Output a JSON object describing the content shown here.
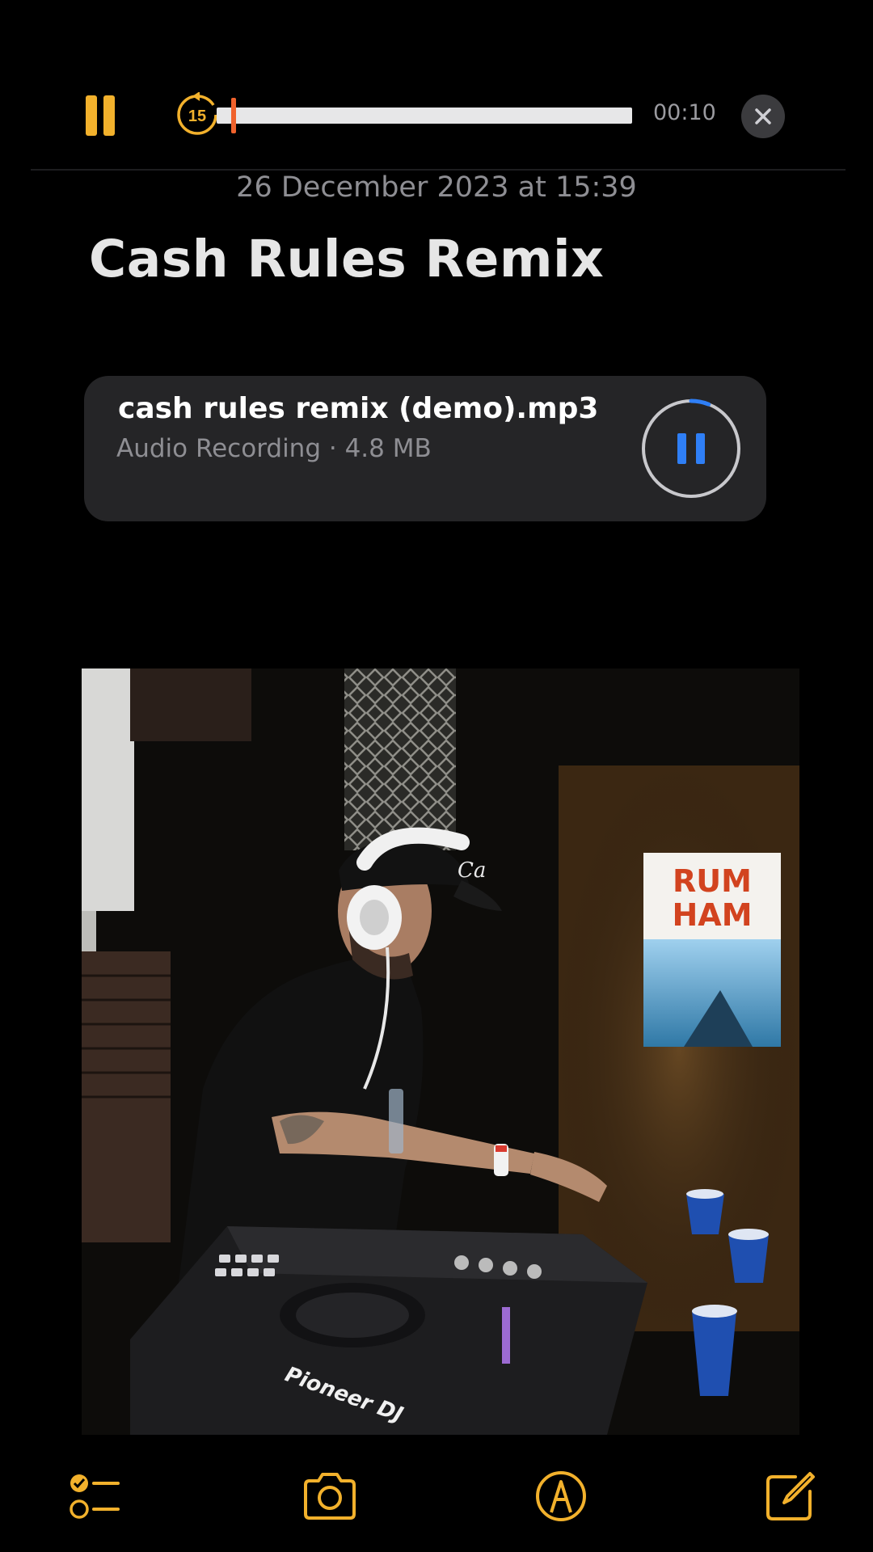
{
  "player": {
    "skip_back_seconds": "15",
    "elapsed": "00:10",
    "progress": 0.04,
    "accent_color": "#f2b12c",
    "playhead_color": "#f0622c"
  },
  "note": {
    "date": "26 December 2023 at 15:39",
    "title": "Cash Rules Remix"
  },
  "attachment": {
    "file_name": "cash rules remix (demo).mp3",
    "meta": "Audio Recording · 4.8 MB",
    "progress": 0.06,
    "accent_color": "#2f7ff6"
  },
  "photo": {
    "poster_text_line1": "RUM",
    "poster_text_line2": "HAM",
    "mixer_brand": "Pioneer DJ"
  },
  "toolbar": {
    "items": [
      "checklist-icon",
      "camera-icon",
      "markup-icon",
      "compose-icon"
    ]
  }
}
